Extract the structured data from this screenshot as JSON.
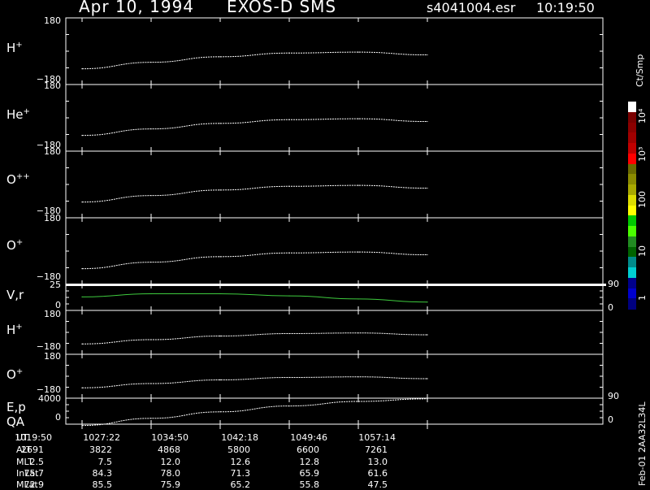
{
  "header": {
    "date": "Apr 10, 1994",
    "instrument": "EXOS-D SMS",
    "file": "s4041004.esr",
    "time": "10:19:50"
  },
  "colorbar": {
    "unit": "Ct/Smp",
    "labels": [
      "10⁴",
      "10³",
      "100",
      "10",
      "1"
    ],
    "colors": [
      "#ffffff",
      "#7a0000",
      "#8b0000",
      "#a00000",
      "#c00000",
      "#ff0000",
      "#6b6b00",
      "#8b8b00",
      "#a8a800",
      "#dddd00",
      "#ffff00",
      "#00c800",
      "#4aff00",
      "#228b22",
      "#006400",
      "#008b8b",
      "#00ced1",
      "#00008b",
      "#0000cd",
      "#000080"
    ]
  },
  "side_label": "Feb-01 2AA32L34L",
  "footer": {
    "row_labels": [
      "UT",
      "ALT",
      "MLT",
      "InLat",
      "MLat"
    ],
    "ut": [
      "1019:50",
      "1027:22",
      "1034:50",
      "1042:18",
      "1049:46",
      "1057:14"
    ],
    "alt": [
      "2691",
      "3822",
      "4868",
      "5800",
      "6600",
      "7261"
    ],
    "mlt": [
      "2.5",
      "7.5",
      "12.0",
      "12.6",
      "12.8",
      "13.0"
    ],
    "inlat": [
      "75.7",
      "84.3",
      "78.0",
      "71.3",
      "65.9",
      "61.6"
    ],
    "mlat": [
      "72.9",
      "85.5",
      "75.9",
      "65.2",
      "55.8",
      "47.5"
    ]
  },
  "chart_data": [
    {
      "type": "line",
      "panel_label": "H+",
      "ylim": [
        -180,
        180
      ],
      "tick_labels": [
        "180",
        "−180"
      ],
      "x": [
        0,
        0.2,
        0.4,
        0.6,
        0.8,
        1.0
      ],
      "values": [
        -95,
        -60,
        -30,
        -10,
        -5,
        -20
      ]
    },
    {
      "type": "line",
      "panel_label": "He+",
      "ylim": [
        -180,
        180
      ],
      "tick_labels": [
        "180",
        "−180"
      ],
      "x": [
        0,
        0.2,
        0.4,
        0.6,
        0.8,
        1.0
      ],
      "values": [
        -95,
        -60,
        -30,
        -10,
        -5,
        -20
      ]
    },
    {
      "type": "line",
      "panel_label": "O++",
      "ylim": [
        -180,
        180
      ],
      "tick_labels": [
        "180",
        "−180"
      ],
      "x": [
        0,
        0.2,
        0.4,
        0.6,
        0.8,
        1.0
      ],
      "values": [
        -95,
        -60,
        -30,
        -10,
        -5,
        -20
      ]
    },
    {
      "type": "line",
      "panel_label": "O+",
      "ylim": [
        -180,
        180
      ],
      "tick_labels": [
        "180",
        "−180"
      ],
      "x": [
        0,
        0.2,
        0.4,
        0.6,
        0.8,
        1.0
      ],
      "values": [
        -95,
        -60,
        -30,
        -10,
        -5,
        -20
      ]
    },
    {
      "type": "line",
      "panel_label": "V,r",
      "ylim": [
        0,
        25
      ],
      "tick_labels": [
        "25",
        "0"
      ],
      "right_ticks": [
        "90",
        "0"
      ],
      "x": [
        0,
        0.2,
        0.4,
        0.6,
        0.8,
        1.0
      ],
      "values": [
        13,
        16,
        16,
        14,
        11,
        8
      ]
    },
    {
      "type": "line",
      "panel_label": "H+",
      "ylim": [
        -180,
        180
      ],
      "tick_labels": [
        "180",
        "−180"
      ],
      "x": [
        0,
        0.2,
        0.4,
        0.6,
        0.8,
        1.0
      ],
      "values": [
        -95,
        -60,
        -30,
        -10,
        -5,
        -20
      ]
    },
    {
      "type": "line",
      "panel_label": "O+",
      "ylim": [
        -180,
        180
      ],
      "tick_labels": [
        "180",
        "−180"
      ],
      "x": [
        0,
        0.2,
        0.4,
        0.6,
        0.8,
        1.0
      ],
      "values": [
        -95,
        -60,
        -30,
        -10,
        -5,
        -20
      ]
    },
    {
      "type": "line",
      "panel_label": "E,p",
      "panel_label2": "QA",
      "ylim": [
        0,
        4000
      ],
      "tick_labels": [
        "4000",
        "0"
      ],
      "right_ticks": [
        "90",
        "0"
      ],
      "x": [
        0,
        0.2,
        0.4,
        0.6,
        0.8,
        1.0
      ],
      "values": [
        -200,
        900,
        1900,
        2800,
        3500,
        3900
      ]
    }
  ]
}
